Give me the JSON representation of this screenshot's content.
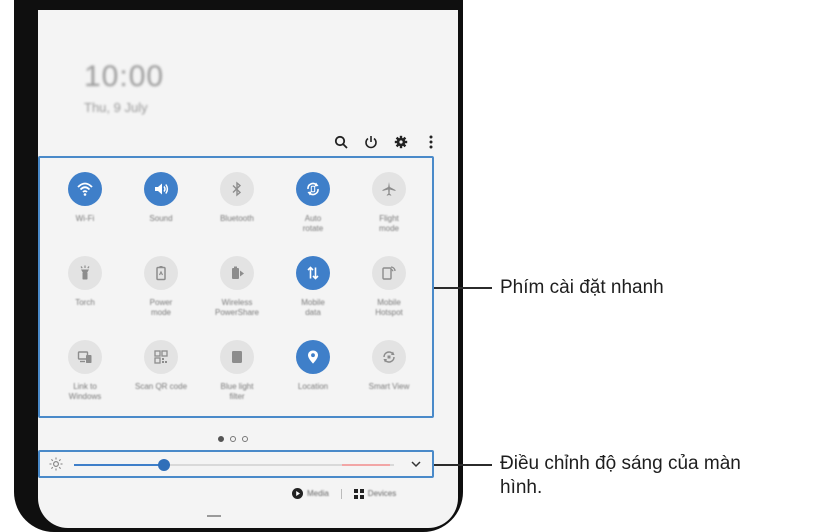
{
  "lock": {
    "time": "10:00",
    "date": "Thu, 9 July"
  },
  "toolbar": {
    "icons": [
      "search-icon",
      "power-icon",
      "settings-gear-icon",
      "more-options-icon"
    ]
  },
  "quick_settings": {
    "tiles": [
      {
        "label": "Wi-Fi",
        "icon": "wifi-icon",
        "on": true
      },
      {
        "label": "Sound",
        "icon": "sound-icon",
        "on": true
      },
      {
        "label": "Bluetooth",
        "icon": "bluetooth-icon",
        "on": false
      },
      {
        "label": "Auto\nrotate",
        "icon": "auto-rotate-icon",
        "on": true
      },
      {
        "label": "Flight\nmode",
        "icon": "airplane-icon",
        "on": false
      },
      {
        "label": "Torch",
        "icon": "torch-icon",
        "on": false
      },
      {
        "label": "Power\nmode",
        "icon": "power-mode-icon",
        "on": false
      },
      {
        "label": "Wireless\nPowerShare",
        "icon": "powershare-icon",
        "on": false
      },
      {
        "label": "Mobile\ndata",
        "icon": "mobile-data-icon",
        "on": true
      },
      {
        "label": "Mobile\nHotspot",
        "icon": "hotspot-icon",
        "on": false
      },
      {
        "label": "Link to\nWindows",
        "icon": "link-windows-icon",
        "on": false
      },
      {
        "label": "Scan QR code",
        "icon": "qr-code-icon",
        "on": false
      },
      {
        "label": "Blue light\nfilter",
        "icon": "blue-light-icon",
        "on": false
      },
      {
        "label": "Location",
        "icon": "location-icon",
        "on": true
      },
      {
        "label": "Smart View",
        "icon": "smart-view-icon",
        "on": false
      }
    ]
  },
  "pager": {
    "pages": 3,
    "active": 0
  },
  "brightness": {
    "level": 0.28
  },
  "footer": {
    "media_label": "Media",
    "devices_label": "Devices"
  },
  "annotations": {
    "quick_settings": "Phím cài đặt nhanh",
    "brightness_line1": "Điều chỉnh độ sáng của màn",
    "brightness_line2": "hình."
  },
  "colors": {
    "accent": "#3f7fc9",
    "highlight_box": "#4a8ac9"
  }
}
